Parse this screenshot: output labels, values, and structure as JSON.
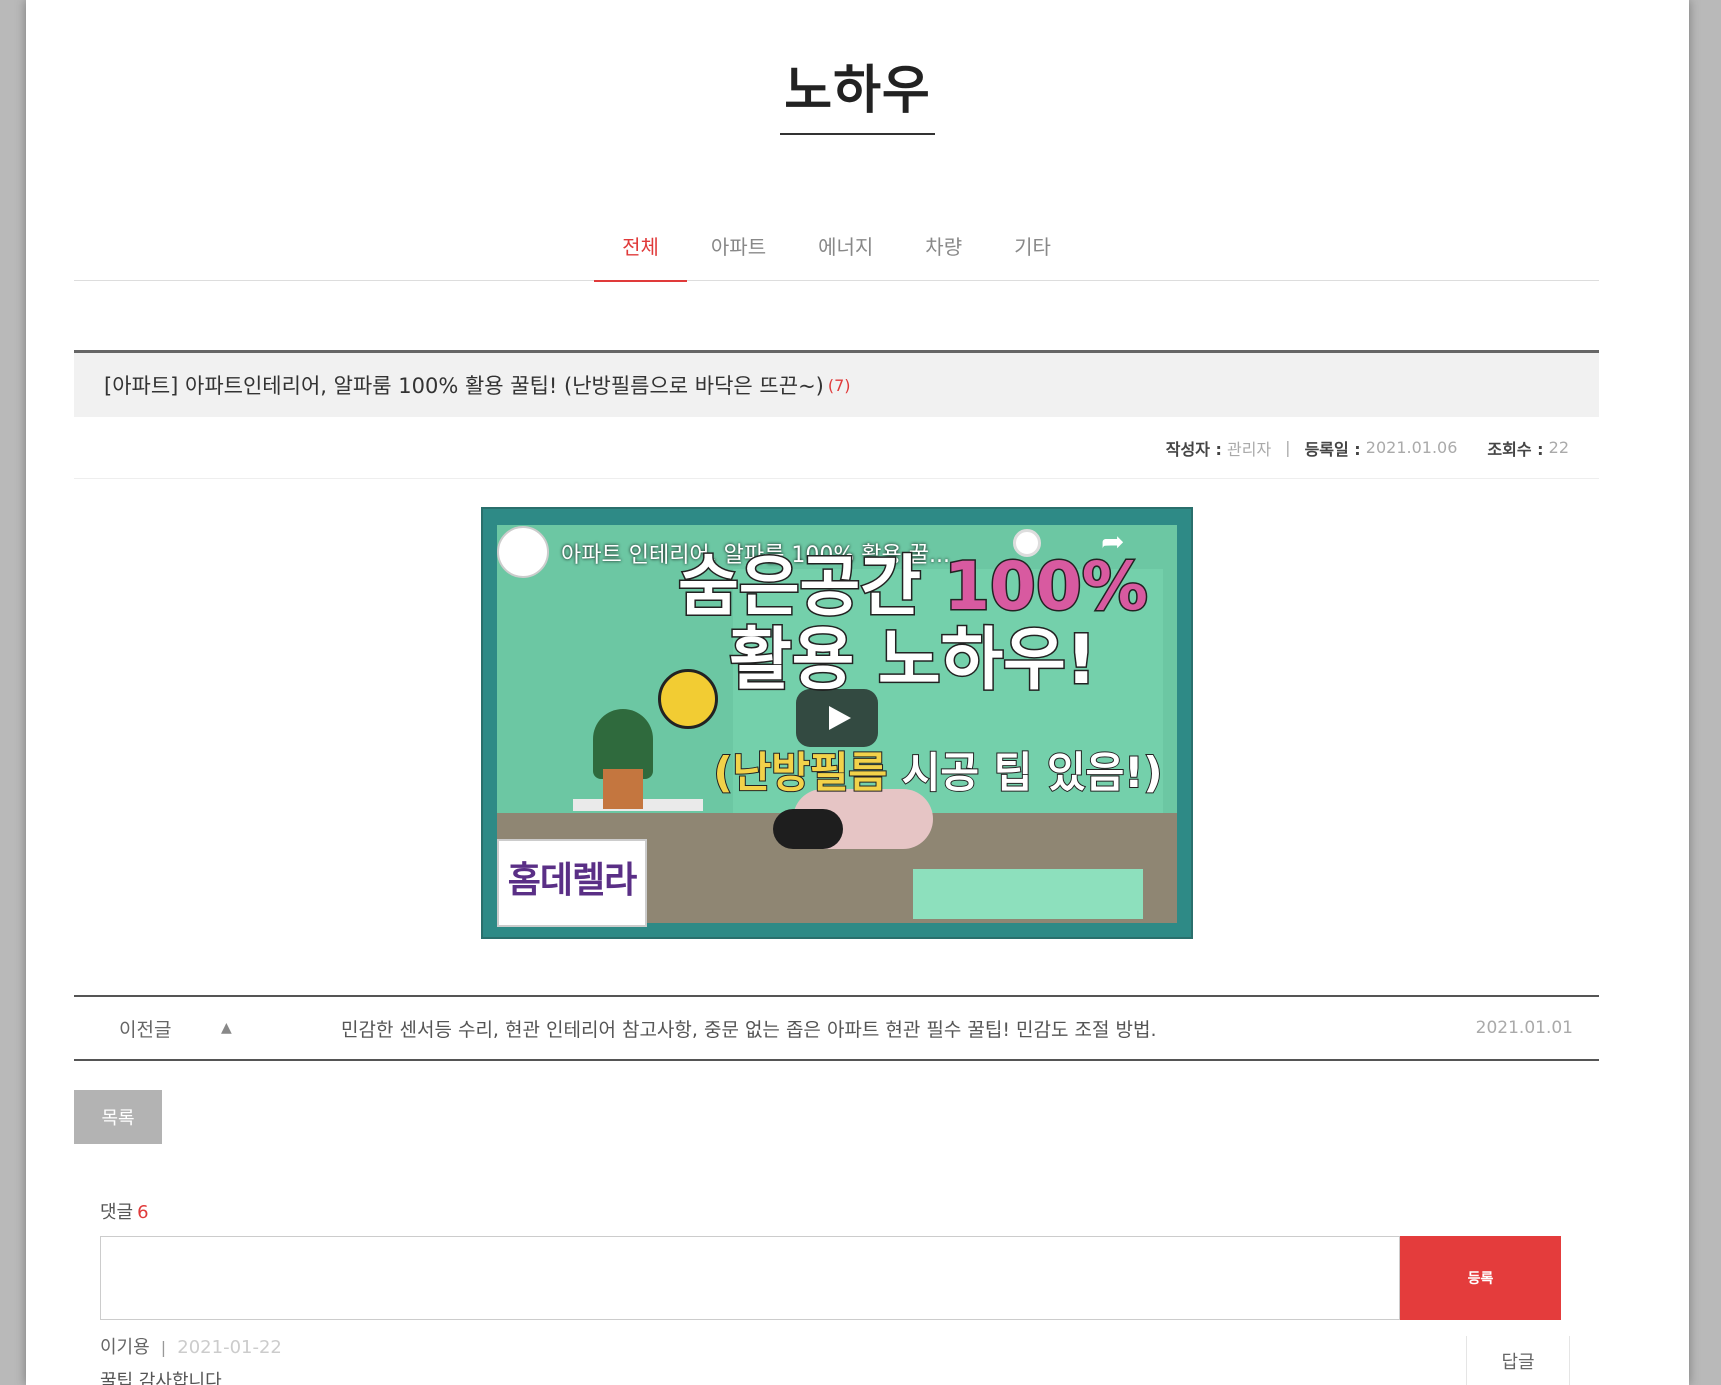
{
  "page": {
    "title": "노하우"
  },
  "tabs": [
    {
      "label": "전체",
      "active": true
    },
    {
      "label": "아파트",
      "active": false
    },
    {
      "label": "에너지",
      "active": false
    },
    {
      "label": "차량",
      "active": false
    },
    {
      "label": "기타",
      "active": false
    }
  ],
  "post": {
    "title": "[아파트] 아파트인테리어, 알파룸 100% 활용 꿀팁! (난방필름으로 바닥은 뜨끈~)",
    "comment_count": "(7)",
    "meta": {
      "author_label": "작성자 :",
      "author": "관리자",
      "date_label": "등록일 :",
      "date": "2021.01.06",
      "views_label": "조회수 :",
      "views": "22"
    }
  },
  "video": {
    "title": "아파트 인테리어, 알파룸 100% 활용 꿀...",
    "headline_1": "숨은공간",
    "headline_1b": "100%",
    "headline_2": "활용 노하우!",
    "headline_3a": "(난방필름",
    "headline_3b": " 시공 팁 있음!)",
    "logo_text": "홈데렐라",
    "share_icon": "share-icon",
    "clock_icon": "watch-later-icon"
  },
  "nav": {
    "prev_label": "이전글",
    "prev_title": "민감한 센서등 수리, 현관 인테리어 참고사항, 중문 없는 좁은 아파트 현관 필수 꿀팁! 민감도 조절 방법.",
    "prev_date": "2021.01.01"
  },
  "list_button": "목록",
  "comments": {
    "label": "댓글",
    "count": "6",
    "submit_label": "등록",
    "items": [
      {
        "author": "이기용",
        "date": "2021-01-22",
        "text": "꿀팁 감사합니다",
        "reply_label": "답글"
      }
    ]
  },
  "colors": {
    "accent": "#e03a3a",
    "submit": "#e43c3c",
    "list_button": "#b3b3b3"
  }
}
